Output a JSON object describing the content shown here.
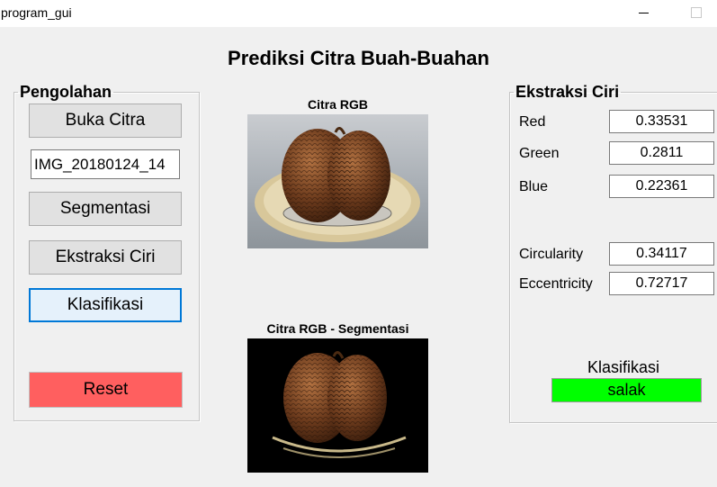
{
  "window": {
    "title": "program_gui"
  },
  "main_title": "Prediksi Citra Buah-Buahan",
  "pengolahan": {
    "legend": "Pengolahan",
    "buka_citra": "Buka Citra",
    "filename": "IMG_20180124_14",
    "segmentasi": "Segmentasi",
    "ekstraksi_ciri": "Ekstraksi Ciri",
    "klasifikasi": "Klasifikasi",
    "reset": "Reset"
  },
  "images": {
    "rgb_title": "Citra RGB",
    "seg_title": "Citra RGB - Segmentasi"
  },
  "ekstraksi": {
    "legend": "Ekstraksi Ciri",
    "red_label": "Red",
    "red_value": "0.33531",
    "green_label": "Green",
    "green_value": "0.2811",
    "blue_label": "Blue",
    "blue_value": "0.22361",
    "circularity_label": "Circularity",
    "circularity_value": "0.34117",
    "eccentricity_label": "Eccentricity",
    "eccentricity_value": "0.72717",
    "klasifikasi_label": "Klasifikasi",
    "klasifikasi_result": "salak"
  },
  "colors": {
    "reset_button": "#ff5f5f",
    "result_background": "#00ff00",
    "focused_border": "#0078d7"
  }
}
